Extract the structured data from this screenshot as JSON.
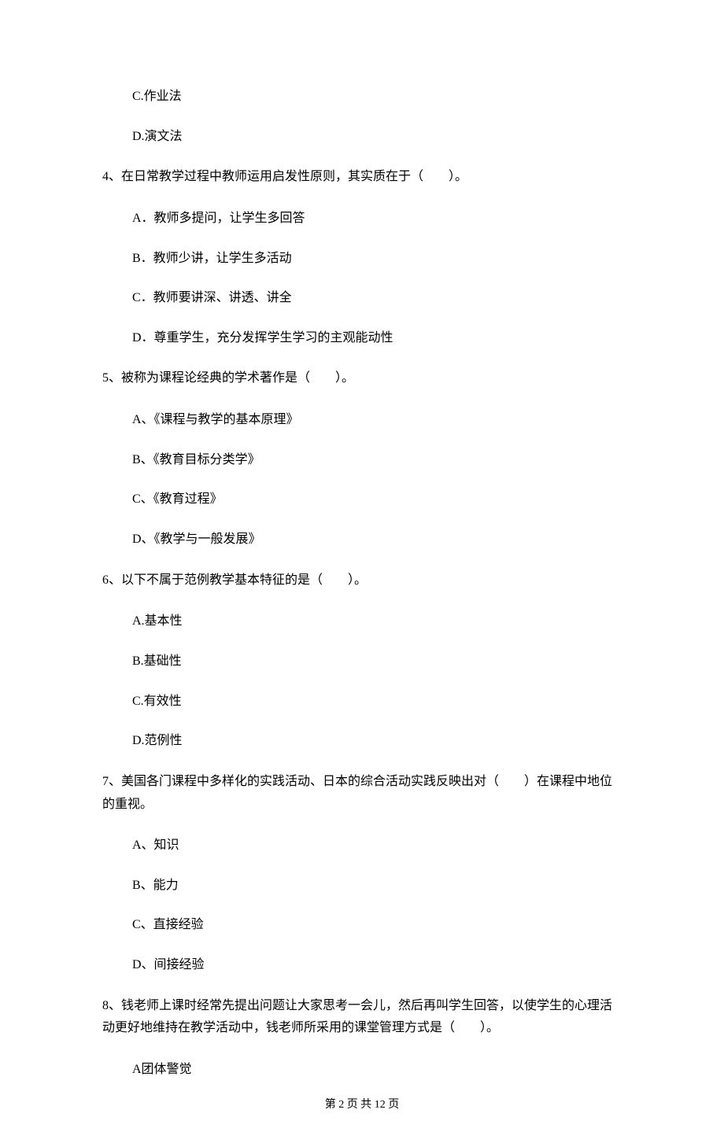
{
  "q3_options": {
    "C": "C.作业法",
    "D": "D.演文法"
  },
  "questions": {
    "q4": {
      "stem": "4、在日常教学过程中教师运用启发性原则，其实质在于（　　）。",
      "options": {
        "A": "A．教师多提问，让学生多回答",
        "B": "B．教师少讲，让学生多活动",
        "C": "C．教师要讲深、讲透、讲全",
        "D": "D．尊重学生，充分发挥学生学习的主观能动性"
      }
    },
    "q5": {
      "stem": "5、被称为课程论经典的学术著作是（　　）。",
      "options": {
        "A": "A、《课程与教学的基本原理》",
        "B": "B、《教育目标分类学》",
        "C": "C、《教育过程》",
        "D": "D、《教学与一般发展》"
      }
    },
    "q6": {
      "stem": "6、以下不属于范例教学基本特征的是（　　）。",
      "options": {
        "A": "A.基本性",
        "B": "B.基础性",
        "C": "C.有效性",
        "D": "D.范例性"
      }
    },
    "q7": {
      "stem": "7、美国各门课程中多样化的实践活动、日本的综合活动实践反映出对（　　）在课程中地位的重视。",
      "options": {
        "A": "A、知识",
        "B": "B、能力",
        "C": "C、直接经验",
        "D": "D、间接经验"
      }
    },
    "q8": {
      "stem": "8、钱老师上课时经常先提出问题让大家思考一会儿，然后再叫学生回答，以使学生的心理活动更好地维持在教学活动中，钱老师所采用的课堂管理方式是（　　）。",
      "options": {
        "A": "A团体警觉"
      }
    }
  },
  "footer": "第 2 页 共 12 页"
}
